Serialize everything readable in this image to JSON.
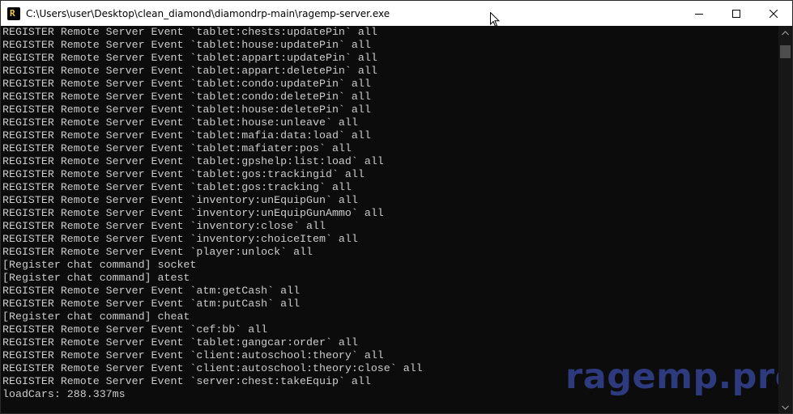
{
  "window": {
    "title": "C:\\Users\\user\\Desktop\\clean_diamond\\diamondrp-main\\ragemp-server.exe",
    "app_icon_glyph": "R",
    "controls": [
      "minimize-icon",
      "maximize-icon",
      "close-icon"
    ]
  },
  "console": {
    "text_color": "#cccccc",
    "background": "#0c0c0c",
    "lines": [
      "REGISTER Remote Server Event `tablet:chests:updatePin` all",
      "REGISTER Remote Server Event `tablet:house:updatePin` all",
      "REGISTER Remote Server Event `tablet:appart:updatePin` all",
      "REGISTER Remote Server Event `tablet:appart:deletePin` all",
      "REGISTER Remote Server Event `tablet:condo:updatePin` all",
      "REGISTER Remote Server Event `tablet:condo:deletePin` all",
      "REGISTER Remote Server Event `tablet:house:deletePin` all",
      "REGISTER Remote Server Event `tablet:house:unleave` all",
      "REGISTER Remote Server Event `tablet:mafia:data:load` all",
      "REGISTER Remote Server Event `tablet:mafiater:pos` all",
      "REGISTER Remote Server Event `tablet:gpshelp:list:load` all",
      "REGISTER Remote Server Event `tablet:gos:trackingid` all",
      "REGISTER Remote Server Event `tablet:gos:tracking` all",
      "REGISTER Remote Server Event `inventory:unEquipGun` all",
      "REGISTER Remote Server Event `inventory:unEquipGunAmmo` all",
      "REGISTER Remote Server Event `inventory:close` all",
      "REGISTER Remote Server Event `inventory:choiceItem` all",
      "REGISTER Remote Server Event `player:unlock` all",
      "[Register chat command] socket",
      "[Register chat command] atest",
      "REGISTER Remote Server Event `atm:getCash` all",
      "REGISTER Remote Server Event `atm:putCash` all",
      "[Register chat command] cheat",
      "REGISTER Remote Server Event `cef:bb` all",
      "REGISTER Remote Server Event `tablet:gangcar:order` all",
      "REGISTER Remote Server Event `client:autoschool:theory` all",
      "REGISTER Remote Server Event `client:autoschool:theory:close` all",
      "REGISTER Remote Server Event `server:chest:takeEquip` all",
      "loadCars: 288.337ms"
    ]
  },
  "watermark": {
    "text": "ragemp.pro",
    "color": "#2d3a7e"
  }
}
